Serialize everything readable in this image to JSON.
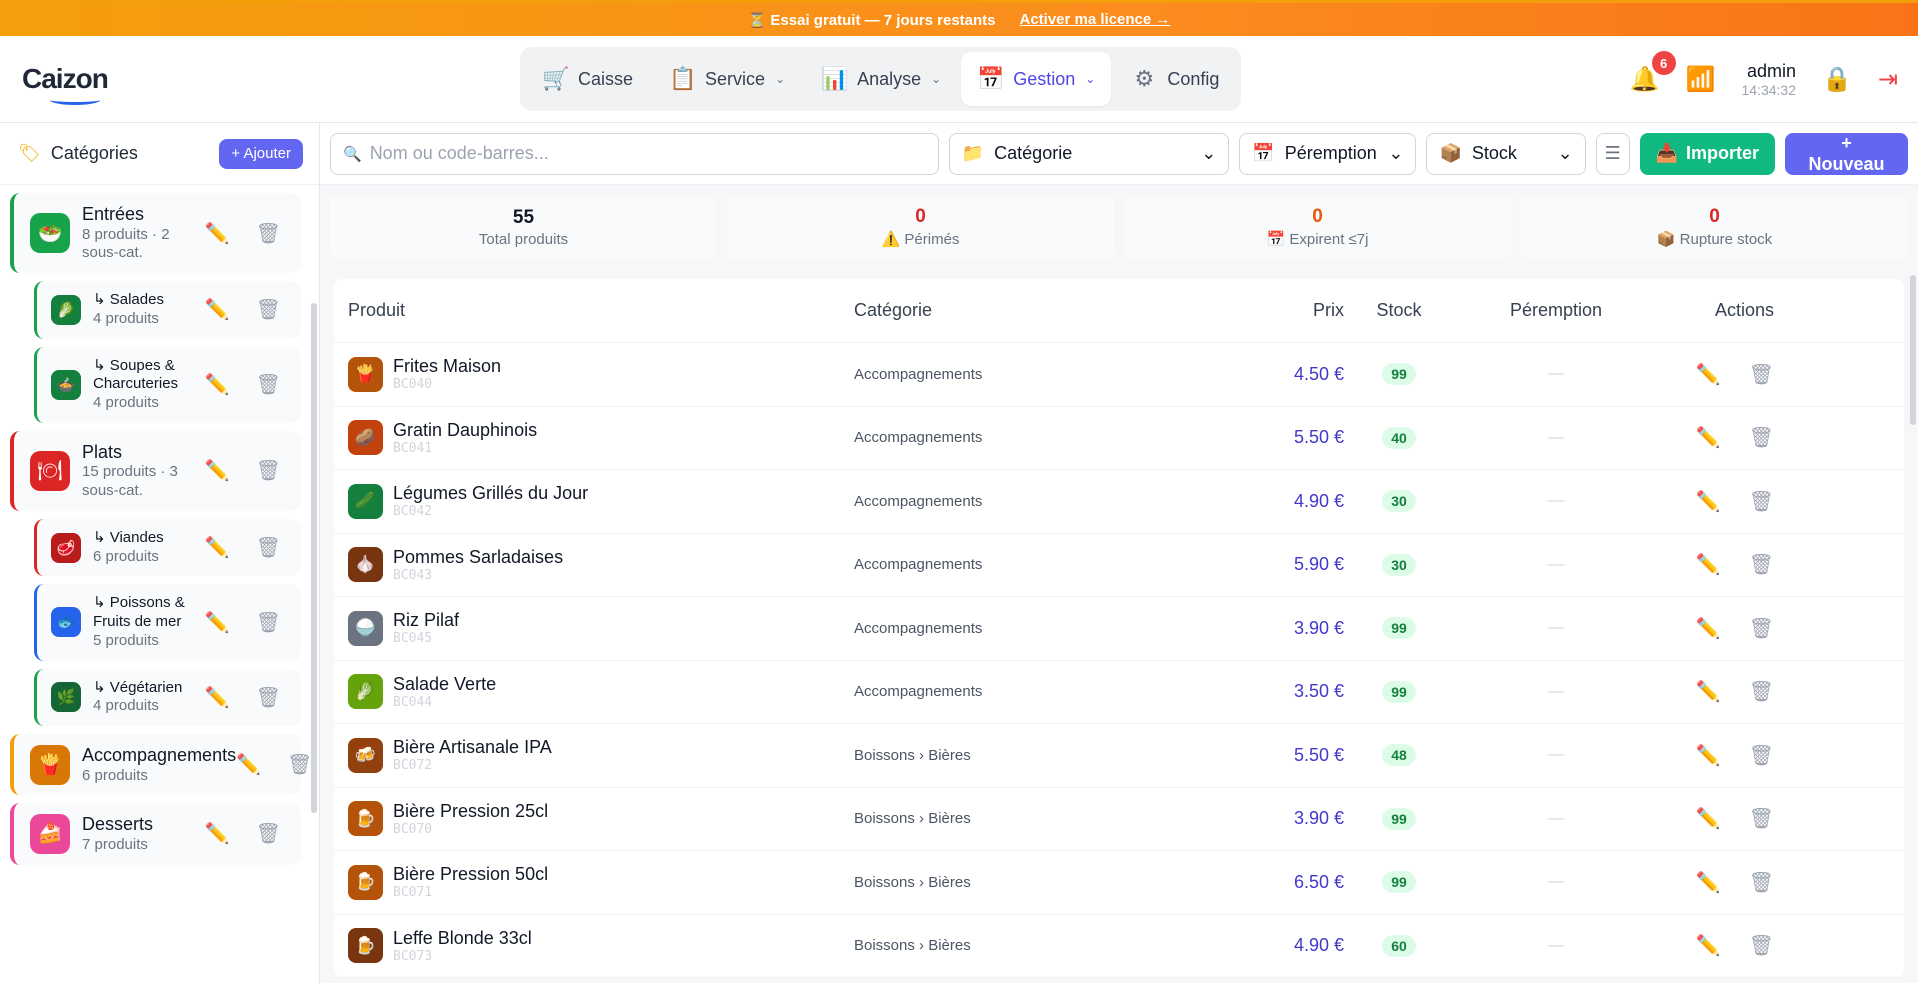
{
  "banner": {
    "text": "⏳ Essai gratuit — 7 jours restants",
    "link": "Activer ma licence →"
  },
  "logo": {
    "c": "C",
    "rest": "aizon"
  },
  "nav": [
    {
      "label": "Caisse",
      "icon": "🛒",
      "chev": ""
    },
    {
      "label": "Service",
      "icon": "📋",
      "chev": "⌄"
    },
    {
      "label": "Analyse",
      "icon": "📊",
      "chev": "⌄"
    },
    {
      "label": "Gestion",
      "icon": "📅",
      "chev": "⌄"
    },
    {
      "label": "Config",
      "icon": "⚙",
      "chev": ""
    }
  ],
  "header": {
    "notif_count": "6",
    "user": "admin",
    "time": "14:34:32"
  },
  "sidebar": {
    "title": "Catégories",
    "add": "+ Ajouter",
    "items": [
      {
        "name": "Entrées",
        "meta": "8 produits · 2 sous-cat.",
        "icon": "🥗"
      },
      {
        "name": "↳ Salades",
        "meta": "4 produits",
        "icon": "🥬"
      },
      {
        "name": "↳ Soupes & Charcuteries",
        "meta": "4 produits",
        "icon": "🍲"
      },
      {
        "name": "Plats",
        "meta": "15 produits · 3 sous-cat.",
        "icon": "🍽"
      },
      {
        "name": "↳ Viandes",
        "meta": "6 produits",
        "icon": "🥩"
      },
      {
        "name": "↳ Poissons & Fruits de mer",
        "meta": "5 produits",
        "icon": "🐟"
      },
      {
        "name": "↳ Végétarien",
        "meta": "4 produits",
        "icon": "🌿"
      },
      {
        "name": "Accompagnements",
        "meta": "6 produits",
        "icon": "🍟"
      },
      {
        "name": "Desserts",
        "meta": "7 produits",
        "icon": "🍰"
      }
    ]
  },
  "toolbar": {
    "search_placeholder": "Nom ou code-barres...",
    "cat_select": "Catégorie",
    "cat_icon": "📁",
    "per_select": "Péremption",
    "per_icon": "📅",
    "stock_select": "Stock",
    "stock_icon": "📦",
    "import": "Importer",
    "import_icon": "📥",
    "new": "+ Nouveau"
  },
  "stats": [
    {
      "value": "55",
      "label": "Total produits",
      "color": "#111827"
    },
    {
      "value": "0",
      "label": "⚠️ Périmés",
      "color": "#dc2626"
    },
    {
      "value": "0",
      "label": "📅 Expirent ≤7j",
      "color": "#ea580c"
    },
    {
      "value": "0",
      "label": "📦 Rupture stock",
      "color": "#dc2626"
    }
  ],
  "table": {
    "headers": {
      "prod": "Produit",
      "cat": "Catégorie",
      "prix": "Prix",
      "stock": "Stock",
      "per": "Péremption",
      "act": "Actions"
    },
    "rows": [
      {
        "name": "Frites Maison",
        "code": "BC040",
        "cat": "Accompagnements",
        "price": "4.50 €",
        "stock": "99",
        "per": "—",
        "icon": "🍟"
      },
      {
        "name": "Gratin Dauphinois",
        "code": "BC041",
        "cat": "Accompagnements",
        "price": "5.50 €",
        "stock": "40",
        "per": "—",
        "icon": "🥔"
      },
      {
        "name": "Légumes Grillés du Jour",
        "code": "BC042",
        "cat": "Accompagnements",
        "price": "4.90 €",
        "stock": "30",
        "per": "—",
        "icon": "🥒"
      },
      {
        "name": "Pommes Sarladaises",
        "code": "BC043",
        "cat": "Accompagnements",
        "price": "5.90 €",
        "stock": "30",
        "per": "—",
        "icon": "🧄"
      },
      {
        "name": "Riz Pilaf",
        "code": "BC045",
        "cat": "Accompagnements",
        "price": "3.90 €",
        "stock": "99",
        "per": "—",
        "icon": "🍚"
      },
      {
        "name": "Salade Verte",
        "code": "BC044",
        "cat": "Accompagnements",
        "price": "3.50 €",
        "stock": "99",
        "per": "—",
        "icon": "🥬"
      },
      {
        "name": "Bière Artisanale IPA",
        "code": "BC072",
        "cat": "Boissons › Bières",
        "price": "5.50 €",
        "stock": "48",
        "per": "—",
        "icon": "🍻"
      },
      {
        "name": "Bière Pression 25cl",
        "code": "BC070",
        "cat": "Boissons › Bières",
        "price": "3.90 €",
        "stock": "99",
        "per": "—",
        "icon": "🍺"
      },
      {
        "name": "Bière Pression 50cl",
        "code": "BC071",
        "cat": "Boissons › Bières",
        "price": "6.50 €",
        "stock": "99",
        "per": "—",
        "icon": "🍺"
      },
      {
        "name": "Leffe Blonde 33cl",
        "code": "BC073",
        "cat": "Boissons › Bières",
        "price": "4.90 €",
        "stock": "60",
        "per": "—",
        "icon": "🍺"
      }
    ]
  }
}
